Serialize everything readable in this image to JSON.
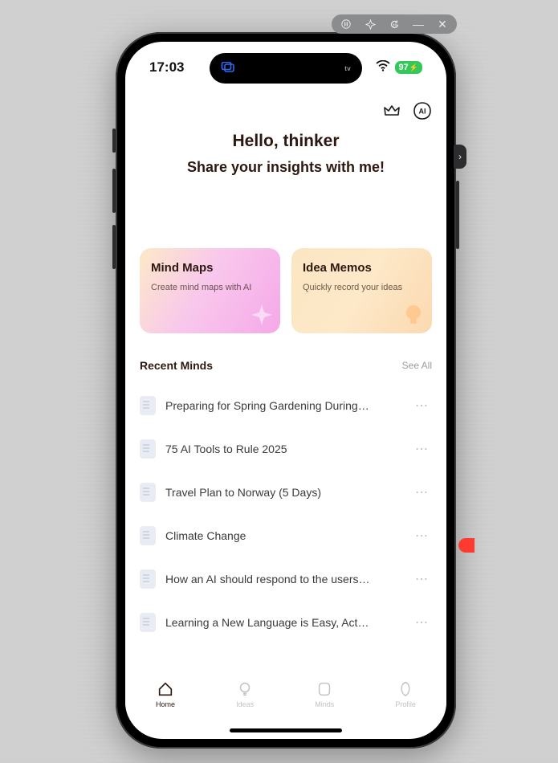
{
  "window_controls": {
    "pause": "⏸",
    "pin": "✦",
    "reset": "↺",
    "minimize": "—",
    "close": "✕"
  },
  "status": {
    "time": "17:03",
    "notch_right": "tv",
    "battery": "97"
  },
  "top": {
    "greeting": "Hello, thinker",
    "subtitle": "Share your insights with me!"
  },
  "cards": {
    "mind_maps": {
      "title": "Mind Maps",
      "sub": "Create mind maps with AI"
    },
    "idea_memos": {
      "title": "Idea Memos",
      "sub": "Quickly record your ideas"
    }
  },
  "recent": {
    "title": "Recent Minds",
    "see_all": "See All",
    "items": [
      {
        "title": "Preparing for Spring Gardening During…"
      },
      {
        "title": "75 AI Tools to Rule 2025"
      },
      {
        "title": "Travel Plan to Norway (5 Days)"
      },
      {
        "title": "Climate Change"
      },
      {
        "title": "How an AI should respond to the users…"
      },
      {
        "title": "Learning a New Language is Easy, Act…"
      }
    ]
  },
  "tabs": {
    "home": "Home",
    "ideas": "Ideas",
    "minds": "Minds",
    "profile": "Profile"
  }
}
